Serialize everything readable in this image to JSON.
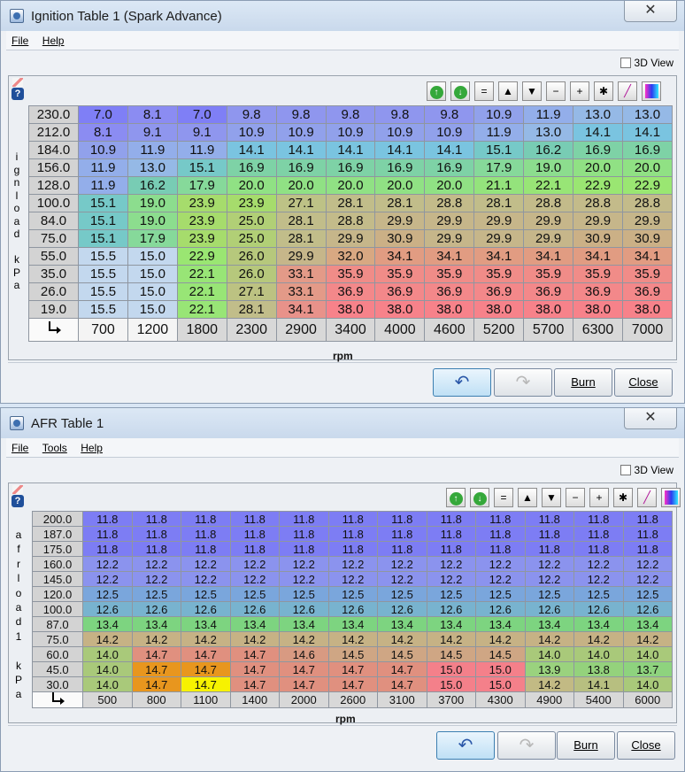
{
  "windows": {
    "ignition": {
      "title": "Ignition Table 1 (Spark Advance)",
      "close_glyph": "✕",
      "menu": [
        "File",
        "Help"
      ],
      "view3d_label": "3D View",
      "y_axis_label": "ignload kPa",
      "x_axis_label": "rpm",
      "buttons": {
        "burn": "Burn",
        "close": "Close"
      },
      "toolbar": [
        "increase-icon",
        "decrease-icon",
        "equals-icon",
        "up-arrow-icon",
        "down-arrow-icon",
        "minus-icon",
        "plus-icon",
        "multiply-icon",
        "pen-icon",
        "color-icon"
      ],
      "toolbar_glyphs": [
        "↑",
        "↓",
        "=",
        "▲",
        "▼",
        "−",
        "+",
        "✱",
        "",
        ""
      ],
      "y_labels": [
        "230.0",
        "212.0",
        "184.0",
        "156.0",
        "128.0",
        "100.0",
        "84.0",
        "75.0",
        "55.0",
        "35.0",
        "26.0",
        "19.0"
      ],
      "x_labels": [
        "700",
        "1200",
        "1800",
        "2300",
        "2900",
        "3400",
        "4000",
        "4600",
        "5200",
        "5700",
        "6300",
        "7000"
      ],
      "cells": [
        [
          "7.0",
          "8.1",
          "7.0",
          "9.8",
          "9.8",
          "9.8",
          "9.8",
          "9.8",
          "10.9",
          "11.9",
          "13.0",
          "13.0"
        ],
        [
          "8.1",
          "9.1",
          "9.1",
          "10.9",
          "10.9",
          "10.9",
          "10.9",
          "10.9",
          "11.9",
          "13.0",
          "14.1",
          "14.1"
        ],
        [
          "10.9",
          "11.9",
          "11.9",
          "14.1",
          "14.1",
          "14.1",
          "14.1",
          "14.1",
          "15.1",
          "16.2",
          "16.9",
          "16.9"
        ],
        [
          "11.9",
          "13.0",
          "15.1",
          "16.9",
          "16.9",
          "16.9",
          "16.9",
          "16.9",
          "17.9",
          "19.0",
          "20.0",
          "20.0"
        ],
        [
          "11.9",
          "16.2",
          "17.9",
          "20.0",
          "20.0",
          "20.0",
          "20.0",
          "20.0",
          "21.1",
          "22.1",
          "22.9",
          "22.9"
        ],
        [
          "15.1",
          "19.0",
          "23.9",
          "23.9",
          "27.1",
          "28.1",
          "28.1",
          "28.8",
          "28.1",
          "28.8",
          "28.8",
          "28.8"
        ],
        [
          "15.1",
          "19.0",
          "23.9",
          "25.0",
          "28.1",
          "28.8",
          "29.9",
          "29.9",
          "29.9",
          "29.9",
          "29.9",
          "29.9"
        ],
        [
          "15.1",
          "17.9",
          "23.9",
          "25.0",
          "28.1",
          "29.9",
          "30.9",
          "29.9",
          "29.9",
          "29.9",
          "30.9",
          "30.9"
        ],
        [
          "15.5",
          "15.0",
          "22.9",
          "26.0",
          "29.9",
          "32.0",
          "34.1",
          "34.1",
          "34.1",
          "34.1",
          "34.1",
          "34.1"
        ],
        [
          "15.5",
          "15.0",
          "22.1",
          "26.0",
          "33.1",
          "35.9",
          "35.9",
          "35.9",
          "35.9",
          "35.9",
          "35.9",
          "35.9"
        ],
        [
          "15.5",
          "15.0",
          "22.1",
          "27.1",
          "33.1",
          "36.9",
          "36.9",
          "36.9",
          "36.9",
          "36.9",
          "36.9",
          "36.9"
        ],
        [
          "15.5",
          "15.0",
          "22.1",
          "28.1",
          "34.1",
          "38.0",
          "38.0",
          "38.0",
          "38.0",
          "38.0",
          "38.0",
          "38.0"
        ]
      ],
      "colors": [
        [
          "#7f7ff6",
          "#8b8cf2",
          "#7f7ff6",
          "#8f96ee",
          "#8f96ee",
          "#8f96ee",
          "#8f96ee",
          "#8f96ee",
          "#91a1eb",
          "#93aeea",
          "#95b9e6",
          "#95b9e6"
        ],
        [
          "#8b8cf2",
          "#8f96ee",
          "#8f96ee",
          "#91a1eb",
          "#91a1eb",
          "#91a1eb",
          "#91a1eb",
          "#91a1eb",
          "#93aeea",
          "#95b9e6",
          "#7ac4e0",
          "#7ac4e0"
        ],
        [
          "#91a1eb",
          "#93aeea",
          "#93aeea",
          "#7ac4e0",
          "#7ac4e0",
          "#7ac4e0",
          "#7ac4e0",
          "#7ac4e0",
          "#76c9c8",
          "#78ccb4",
          "#7ed2a6",
          "#7ed2a6"
        ],
        [
          "#93aeea",
          "#95b9e6",
          "#76c9c8",
          "#7ed2a6",
          "#7ed2a6",
          "#7ed2a6",
          "#7ed2a6",
          "#7ed2a6",
          "#86d99a",
          "#8cdd8e",
          "#90e184",
          "#90e184"
        ],
        [
          "#93aeea",
          "#78ccb4",
          "#86d99a",
          "#90e184",
          "#90e184",
          "#90e184",
          "#90e184",
          "#90e184",
          "#94e37c",
          "#98e576",
          "#9ae672",
          "#9ae672"
        ],
        [
          "#76c9c8",
          "#8cdd8e",
          "#a6dc6c",
          "#a6dc6c",
          "#bdc286",
          "#c1bd8a",
          "#c1bd8a",
          "#c3bb8a",
          "#c1bd8a",
          "#c3bb8a",
          "#c3bb8a",
          "#c3bb8a"
        ],
        [
          "#76c9c8",
          "#8cdd8e",
          "#a6dc6c",
          "#b1cf76",
          "#c1bd8a",
          "#c3bb8a",
          "#c6b68a",
          "#c6b68a",
          "#c6b68a",
          "#c6b68a",
          "#c6b68a",
          "#c6b68a"
        ],
        [
          "#76c9c8",
          "#86d99a",
          "#a6dc6c",
          "#b1cf76",
          "#c1bd8a",
          "#c6b68a",
          "#cbb086",
          "#c6b68a",
          "#c6b68a",
          "#c6b68a",
          "#cbb086",
          "#cbb086"
        ],
        [
          "#c3d8ee",
          "#c3d8ee",
          "#9ae672",
          "#b6c87c",
          "#c6b68a",
          "#d8a882",
          "#e19c82",
          "#e19c82",
          "#e19c82",
          "#e19c82",
          "#e19c82",
          "#e19c82"
        ],
        [
          "#c3d8ee",
          "#c3d8ee",
          "#98e576",
          "#b6c87c",
          "#e39a88",
          "#f08c88",
          "#f08c88",
          "#f08c88",
          "#f08c88",
          "#f08c88",
          "#f08c88",
          "#f08c88"
        ],
        [
          "#c3d8ee",
          "#c3d8ee",
          "#98e576",
          "#bcc282",
          "#e39a88",
          "#f3888a",
          "#f3888a",
          "#f3888a",
          "#f3888a",
          "#f3888a",
          "#f3888a",
          "#f3888a"
        ],
        [
          "#c3d8ee",
          "#c3d8ee",
          "#98e576",
          "#c1bd8a",
          "#e8928a",
          "#f7828a",
          "#f7828a",
          "#f7828a",
          "#f7828a",
          "#f7828a",
          "#f7828a",
          "#f7828a"
        ]
      ]
    },
    "afr": {
      "title": "AFR Table 1",
      "close_glyph": "✕",
      "menu": [
        "File",
        "Tools",
        "Help"
      ],
      "view3d_label": "3D View",
      "y_axis_label": "afrload1 kPa",
      "x_axis_label": "rpm",
      "buttons": {
        "burn": "Burn",
        "close": "Close"
      },
      "toolbar": [
        "increase-icon",
        "decrease-icon",
        "equals-icon",
        "up-arrow-icon",
        "down-arrow-icon",
        "minus-icon",
        "plus-icon",
        "multiply-icon",
        "pen-icon",
        "color-icon"
      ],
      "toolbar_glyphs": [
        "↑",
        "↓",
        "=",
        "▲",
        "▼",
        "−",
        "+",
        "✱",
        "",
        ""
      ],
      "y_labels": [
        "200.0",
        "187.0",
        "175.0",
        "160.0",
        "145.0",
        "120.0",
        "100.0",
        "87.0",
        "75.0",
        "60.0",
        "45.0",
        "30.0"
      ],
      "x_labels": [
        "500",
        "800",
        "1100",
        "1400",
        "2000",
        "2600",
        "3100",
        "3700",
        "4300",
        "4900",
        "5400",
        "6000"
      ],
      "cells": [
        [
          "11.8",
          "11.8",
          "11.8",
          "11.8",
          "11.8",
          "11.8",
          "11.8",
          "11.8",
          "11.8",
          "11.8",
          "11.8",
          "11.8"
        ],
        [
          "11.8",
          "11.8",
          "11.8",
          "11.8",
          "11.8",
          "11.8",
          "11.8",
          "11.8",
          "11.8",
          "11.8",
          "11.8",
          "11.8"
        ],
        [
          "11.8",
          "11.8",
          "11.8",
          "11.8",
          "11.8",
          "11.8",
          "11.8",
          "11.8",
          "11.8",
          "11.8",
          "11.8",
          "11.8"
        ],
        [
          "12.2",
          "12.2",
          "12.2",
          "12.2",
          "12.2",
          "12.2",
          "12.2",
          "12.2",
          "12.2",
          "12.2",
          "12.2",
          "12.2"
        ],
        [
          "12.2",
          "12.2",
          "12.2",
          "12.2",
          "12.2",
          "12.2",
          "12.2",
          "12.2",
          "12.2",
          "12.2",
          "12.2",
          "12.2"
        ],
        [
          "12.5",
          "12.5",
          "12.5",
          "12.5",
          "12.5",
          "12.5",
          "12.5",
          "12.5",
          "12.5",
          "12.5",
          "12.5",
          "12.5"
        ],
        [
          "12.6",
          "12.6",
          "12.6",
          "12.6",
          "12.6",
          "12.6",
          "12.6",
          "12.6",
          "12.6",
          "12.6",
          "12.6",
          "12.6"
        ],
        [
          "13.4",
          "13.4",
          "13.4",
          "13.4",
          "13.4",
          "13.4",
          "13.4",
          "13.4",
          "13.4",
          "13.4",
          "13.4",
          "13.4"
        ],
        [
          "14.2",
          "14.2",
          "14.2",
          "14.2",
          "14.2",
          "14.2",
          "14.2",
          "14.2",
          "14.2",
          "14.2",
          "14.2",
          "14.2"
        ],
        [
          "14.0",
          "14.7",
          "14.7",
          "14.7",
          "14.6",
          "14.5",
          "14.5",
          "14.5",
          "14.5",
          "14.0",
          "14.0",
          "14.0"
        ],
        [
          "14.0",
          "14.7",
          "14.7",
          "14.7",
          "14.7",
          "14.7",
          "14.7",
          "15.0",
          "15.0",
          "13.9",
          "13.8",
          "13.7"
        ],
        [
          "14.0",
          "14.7",
          "14.7",
          "14.7",
          "14.7",
          "14.7",
          "14.7",
          "15.0",
          "15.0",
          "14.2",
          "14.1",
          "14.0"
        ]
      ],
      "colors": [
        [
          "#7d7df4",
          "#7d7df4",
          "#7d7df4",
          "#7d7df4",
          "#7d7df4",
          "#7d7df4",
          "#7d7df4",
          "#7d7df4",
          "#7d7df4",
          "#7d7df4",
          "#7d7df4",
          "#7d7df4"
        ],
        [
          "#7d7df4",
          "#7d7df4",
          "#7d7df4",
          "#7d7df4",
          "#7d7df4",
          "#7d7df4",
          "#7d7df4",
          "#7d7df4",
          "#7d7df4",
          "#7d7df4",
          "#7d7df4",
          "#7d7df4"
        ],
        [
          "#7d7df4",
          "#7d7df4",
          "#7d7df4",
          "#7d7df4",
          "#7d7df4",
          "#7d7df4",
          "#7d7df4",
          "#7d7df4",
          "#7d7df4",
          "#7d7df4",
          "#7d7df4",
          "#7d7df4"
        ],
        [
          "#8b93ee",
          "#8b93ee",
          "#8b93ee",
          "#8b93ee",
          "#8b93ee",
          "#8b93ee",
          "#8b93ee",
          "#8b93ee",
          "#8b93ee",
          "#8b93ee",
          "#8b93ee",
          "#8b93ee"
        ],
        [
          "#8b93ee",
          "#8b93ee",
          "#8b93ee",
          "#8b93ee",
          "#8b93ee",
          "#8b93ee",
          "#8b93ee",
          "#8b93ee",
          "#8b93ee",
          "#8b93ee",
          "#8b93ee",
          "#8b93ee"
        ],
        [
          "#7aa6dc",
          "#7aa6dc",
          "#7aa6dc",
          "#7aa6dc",
          "#7aa6dc",
          "#7aa6dc",
          "#7aa6dc",
          "#7aa6dc",
          "#7aa6dc",
          "#7aa6dc",
          "#7aa6dc",
          "#7aa6dc"
        ],
        [
          "#78b3cf",
          "#78b3cf",
          "#78b3cf",
          "#78b3cf",
          "#78b3cf",
          "#78b3cf",
          "#78b3cf",
          "#78b3cf",
          "#78b3cf",
          "#78b3cf",
          "#78b3cf",
          "#78b3cf"
        ],
        [
          "#7dd480",
          "#7dd480",
          "#7dd480",
          "#7dd480",
          "#7dd480",
          "#7dd480",
          "#7dd480",
          "#7dd480",
          "#7dd480",
          "#7dd480",
          "#7dd480",
          "#7dd480"
        ],
        [
          "#c6b285",
          "#c6b285",
          "#c6b285",
          "#c6b285",
          "#c6b285",
          "#c6b285",
          "#c6b285",
          "#c6b285",
          "#c6b285",
          "#c6b285",
          "#c6b285",
          "#c6b285"
        ],
        [
          "#a9c97a",
          "#e0907f",
          "#e0907f",
          "#e0907f",
          "#d89a82",
          "#cfa684",
          "#cfa684",
          "#cfa684",
          "#cfa684",
          "#a9c97a",
          "#a9c97a",
          "#a9c97a"
        ],
        [
          "#a9c97a",
          "#e8961e",
          "#e8961e",
          "#e0907f",
          "#e0907f",
          "#e0907f",
          "#e0907f",
          "#f4808a",
          "#f4808a",
          "#9ad27e",
          "#94d27c",
          "#8ed37e"
        ],
        [
          "#a9c97a",
          "#e8961e",
          "#f7f200",
          "#e0907f",
          "#e0907f",
          "#e0907f",
          "#e0907f",
          "#f4808a",
          "#f4808a",
          "#c2ba84",
          "#b7bf80",
          "#a9c97a"
        ]
      ]
    }
  }
}
